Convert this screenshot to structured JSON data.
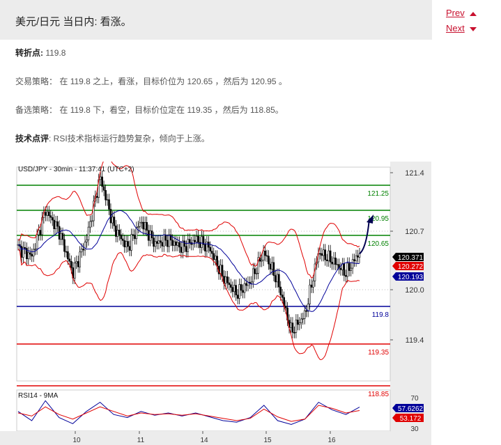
{
  "header": {
    "title": "美元/日元 当日内: 看涨。",
    "prev_label": "Prev",
    "next_label": "Next"
  },
  "analysis": {
    "pivot_label": "转折点:",
    "pivot_value": "119.8",
    "strategy_label": "交易策略：",
    "strategy_text": "在 119.8 之上，看涨，目标价位为 120.65 ，然后为 120.95 。",
    "alternative_label": "备选策略：",
    "alternative_text": "在 119.8 下，看空，目标价位定在 119.35 ，然后为 118.85。",
    "comment_label": "技术点评",
    "comment_text": ": RSI技术指标运行趋势复杂，倾向于上涨。"
  },
  "colors": {
    "accent": "#c8102e",
    "resistance": "#008000",
    "pivot": "#000099",
    "support": "#e00000",
    "bollinger": "#e00000",
    "moving_average": "#000099",
    "arrow": "#000050"
  },
  "chart_data": [
    {
      "type": "candlestick",
      "title": "USD/JPY - 30min - 11:37:41 (UTC+2)",
      "ylim": [
        118.75,
        121.5
      ],
      "y_ticks": [
        "121.4",
        "120.7",
        "120.0",
        "119.4"
      ],
      "x_ticks": [
        "10",
        "11",
        "14",
        "15",
        "16"
      ],
      "levels": [
        {
          "label": "121.25",
          "value": 121.25,
          "kind": "resistance"
        },
        {
          "label": "120.95",
          "value": 120.95,
          "kind": "resistance"
        },
        {
          "label": "120.65",
          "value": 120.65,
          "kind": "resistance"
        },
        {
          "label": "119.8",
          "value": 119.8,
          "kind": "pivot"
        },
        {
          "label": "119.35",
          "value": 119.35,
          "kind": "support"
        },
        {
          "label": "118.85",
          "value": 118.85,
          "kind": "support"
        }
      ],
      "price_tags": [
        {
          "label": "120.371",
          "value": 120.371,
          "color": "#000000"
        },
        {
          "label": "120.272",
          "value": 120.272,
          "color": "#e00000"
        },
        {
          "label": "120.193",
          "value": 120.193,
          "color": "#000099"
        }
      ],
      "close_path": [
        120.5,
        120.4,
        120.95,
        120.7,
        120.2,
        120.6,
        121.35,
        120.75,
        120.5,
        120.82,
        120.55,
        120.6,
        120.5,
        120.6,
        120.5,
        120.15,
        119.95,
        120.1,
        120.45,
        120.1,
        119.5,
        119.7,
        120.45,
        120.35,
        120.2,
        120.45
      ],
      "forecast_target": 120.95
    },
    {
      "type": "line",
      "title": "RSI14 - 9MA",
      "ylim": [
        30,
        70
      ],
      "y_ticks": [
        "70",
        "30"
      ],
      "price_tags": [
        {
          "label": "57.6262",
          "value": 57.6262,
          "color": "#000099"
        },
        {
          "label": "53.172",
          "value": 53.172,
          "color": "#e00000"
        }
      ],
      "series": [
        {
          "values": [
            52,
            40,
            66,
            44,
            36,
            52,
            64,
            48,
            44,
            52,
            47,
            50,
            46,
            50,
            45,
            40,
            38,
            44,
            60,
            40,
            35,
            42,
            64,
            54,
            48,
            57.6
          ]
        },
        {
          "values": [
            50,
            46,
            58,
            48,
            42,
            50,
            58,
            52,
            46,
            50,
            48,
            49,
            47,
            49,
            46,
            43,
            40,
            43,
            55,
            45,
            39,
            42,
            60,
            56,
            50,
            53.2
          ]
        }
      ]
    }
  ]
}
